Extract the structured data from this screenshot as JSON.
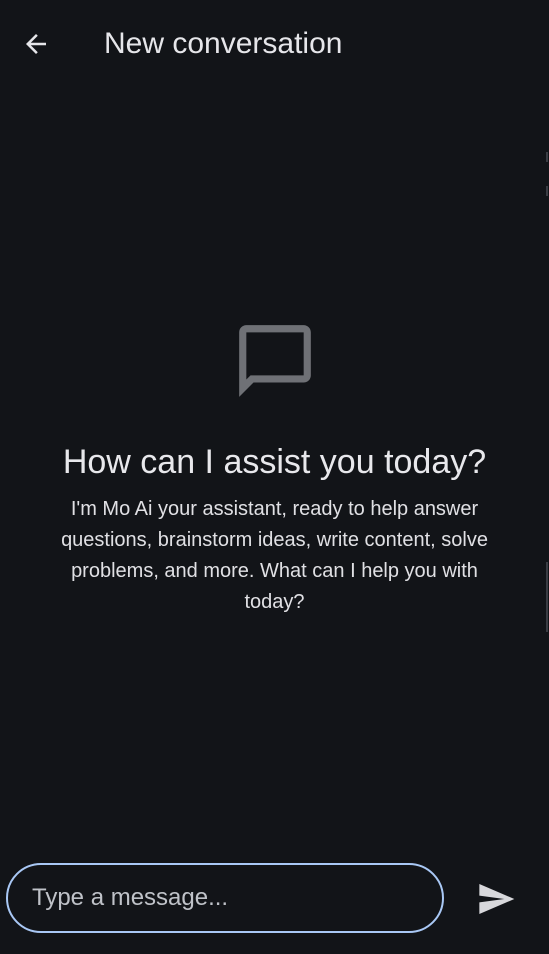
{
  "appbar": {
    "title": "New conversation",
    "back_icon": "arrow-back-icon"
  },
  "empty_state": {
    "icon": "chat-bubble-outline-icon",
    "heading": "How can I assist you today?",
    "description": "I'm Mo Ai your assistant, ready to help answer questions, brainstorm ideas, write content, solve problems, and more. What can I help you with today?"
  },
  "composer": {
    "placeholder": "Type a message...",
    "value": "",
    "send_icon": "send-icon"
  },
  "colors": {
    "background": "#121418",
    "input_border": "#a9c8f5",
    "icon_gray": "#6f7176",
    "text": "#e3e3e6"
  }
}
